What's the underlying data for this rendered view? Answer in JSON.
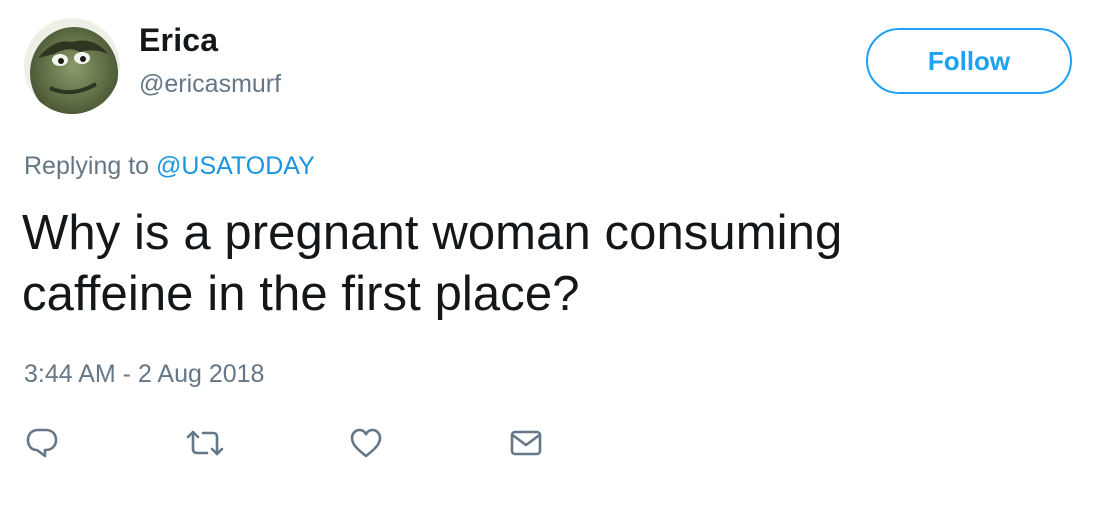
{
  "user": {
    "display_name": "Erica",
    "handle": "@ericasmurf",
    "avatar_icon": "avatar-oscar-the-grouch"
  },
  "follow_button": {
    "label": "Follow"
  },
  "reply_context": {
    "prefix": "Replying to ",
    "mention": "@USATODAY"
  },
  "tweet": {
    "text": "Why is a pregnant woman consuming caffeine in the first place?",
    "timestamp": "3:44 AM - 2 Aug 2018"
  },
  "actions": [
    {
      "name": "reply",
      "icon": "reply-icon"
    },
    {
      "name": "retweet",
      "icon": "retweet-icon"
    },
    {
      "name": "like",
      "icon": "heart-icon"
    },
    {
      "name": "direct-message",
      "icon": "envelope-icon"
    }
  ],
  "colors": {
    "accent": "#1da1f2",
    "mention": "#1b95e0",
    "secondary_text": "#657786",
    "primary_text": "#14171a",
    "icon": "#657786"
  }
}
